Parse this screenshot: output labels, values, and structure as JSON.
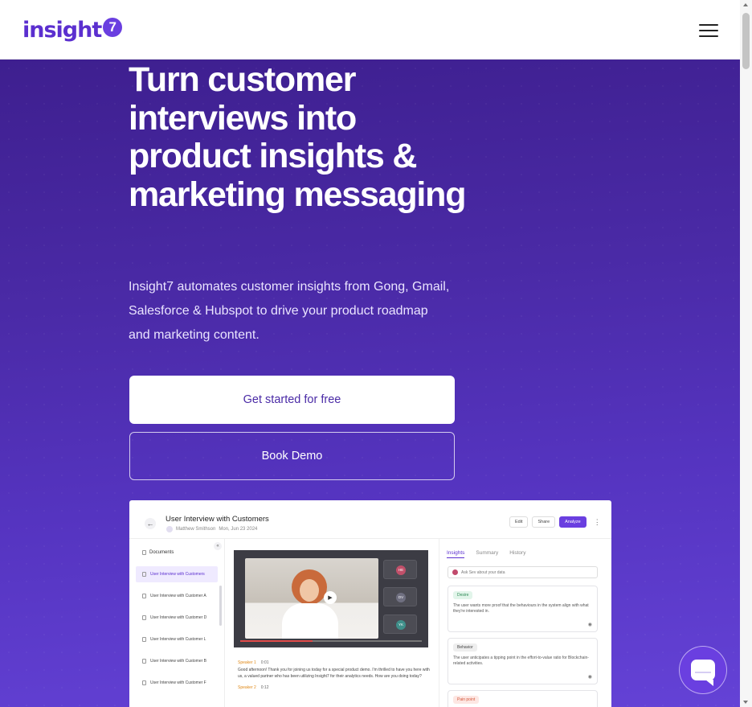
{
  "brand": {
    "logo_text": "insight",
    "logo_mark": "7"
  },
  "header": {
    "menu_icon": "hamburger-menu-icon"
  },
  "hero": {
    "title": "Turn customer interviews into product insights & marketing messaging",
    "subtitle": "Insight7 automates customer insights from Gong, Gmail, Salesforce & Hubspot to drive your product roadmap and marketing content.",
    "primary_cta": "Get started for free",
    "secondary_cta": "Book Demo"
  },
  "preview": {
    "title": "User Interview with Customers",
    "author": "Matthew Smithson",
    "date": "Mon, Jun 23 2024",
    "actions": [
      "Edit",
      "Share",
      "Analyze"
    ],
    "sidebar_title": "Documents",
    "files": [
      "User Interview with Customers",
      "User Interview with Customer A",
      "User Interview with Customer D",
      "User Interview with Customer L",
      "User Interview with Customer B",
      "User Interview with Customer F"
    ],
    "participants": [
      "HE",
      "DV",
      "YK"
    ],
    "progress_fraction": 0.4,
    "transcript": [
      {
        "speaker": "Speaker 1",
        "time": "0:01",
        "text": "Good afternoon! Thank you for joining us today for a special product demo. I'm thrilled to have you here with us, a valued partner who has been utilizing Insight7 for their analytics needs. How are you doing today?"
      },
      {
        "speaker": "Speaker 2",
        "time": "0:12",
        "text": ""
      }
    ],
    "tabs": [
      "Insights",
      "Summary",
      "History"
    ],
    "ask_placeholder": "Ask Sev about your data",
    "insights": [
      {
        "tag": "Desire",
        "text": "The user wants more proof that the behaviours in the system align with what they're interested in."
      },
      {
        "tag": "Behavior",
        "text": "The user anticipates a tipping point in the effort-to-value ratio for Blockchain-related activities."
      },
      {
        "tag": "Pain point",
        "text": ""
      }
    ]
  },
  "colors": {
    "brand": "#5b2fcf",
    "hero_bg": "#4a2aa6",
    "desire_tag": "#e2f5ea",
    "behavior_tag": "#eeeeee",
    "pain_tag": "#fde7e3"
  },
  "chat": {
    "icon": "chat-bubble-icon"
  }
}
